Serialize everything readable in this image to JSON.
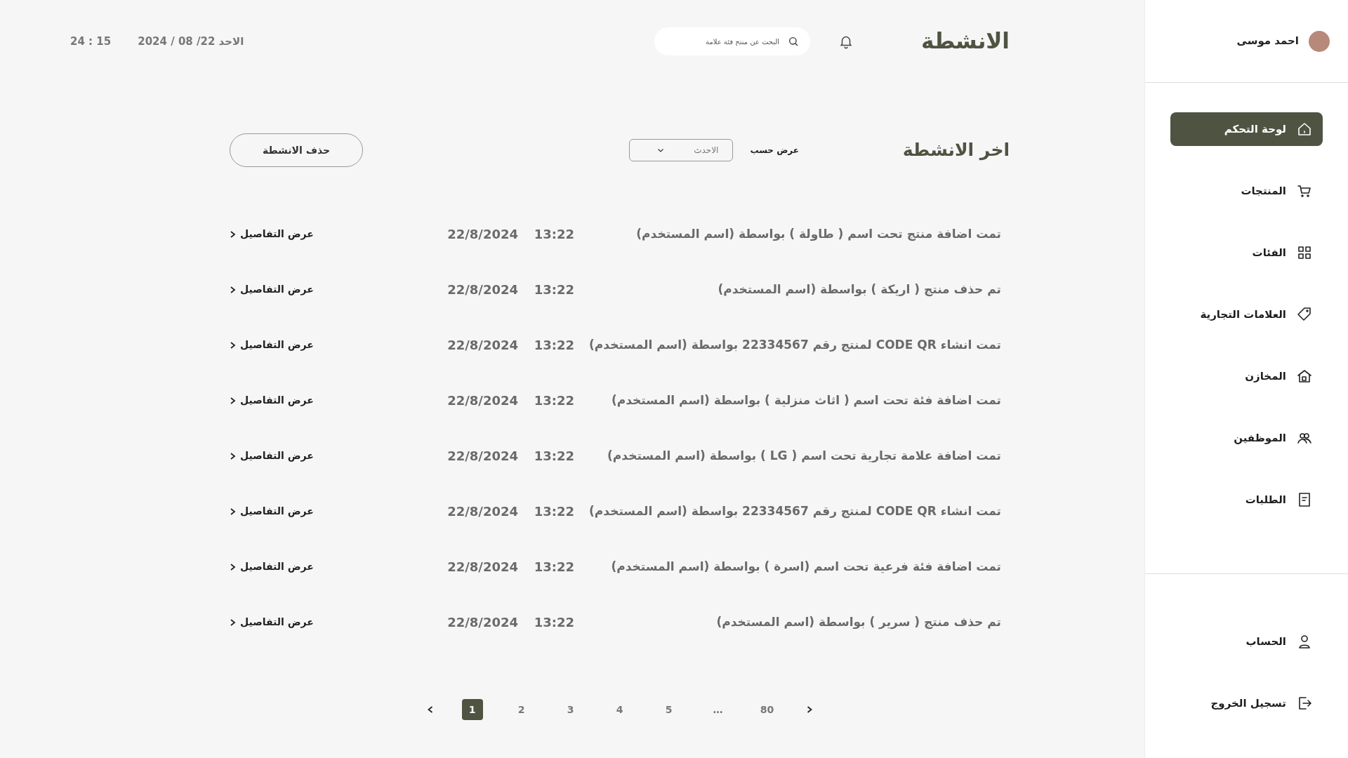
{
  "sidebar": {
    "user": {
      "name": "احمد موسى"
    },
    "items": [
      {
        "label": "لوحة التحكم",
        "selected": true
      },
      {
        "label": "المنتجات",
        "selected": false
      },
      {
        "label": "الفئات",
        "selected": false
      },
      {
        "label": "العلامات التجارية",
        "selected": false
      },
      {
        "label": "المخازن",
        "selected": false
      },
      {
        "label": "الموظفين",
        "selected": false
      },
      {
        "label": "الطلبات",
        "selected": false
      }
    ],
    "account_items": [
      {
        "label": "الحساب"
      },
      {
        "label": "تسجيل الخروج"
      }
    ]
  },
  "header": {
    "title": "الانشطة",
    "search": {
      "placeholder": "البحث عن منتج فئة علامة"
    },
    "date": "الاحد 22/ 08 / 2024",
    "time": "15 : 24"
  },
  "activity": {
    "heading": "اخر الانشطة",
    "sort_label": "عرض حسب",
    "sort_value": "الاحدث",
    "delete_button": "حذف الانشطة",
    "rows": [
      {
        "text": "تمت اضافة منتج تحت اسم ( طاولة ) بواسطة (اسم المستخدم)",
        "time": "13:22",
        "date": "22/8/2024",
        "link": "عرض التفاصيل"
      },
      {
        "text": "تم حذف  منتج ( اريكة )  بواسطة (اسم المستخدم)",
        "time": "13:22",
        "date": "22/8/2024",
        "link": "عرض التفاصيل"
      },
      {
        "text": "تمت انشاء CODE QR لمنتج رقم 22334567 بواسطة (اسم المستخدم)",
        "time": "13:22",
        "date": "22/8/2024",
        "link": "عرض التفاصيل"
      },
      {
        "text": "تمت اضافة فئة  تحت اسم ( اثاث منزلية )  بواسطة (اسم المستخدم)",
        "time": "13:22",
        "date": "22/8/2024",
        "link": "عرض التفاصيل"
      },
      {
        "text": "تمت اضافة علامة تجارية تحت اسم ( LG )  بواسطة (اسم المستخدم)",
        "time": "13:22",
        "date": "22/8/2024",
        "link": "عرض التفاصيل"
      },
      {
        "text": "تمت انشاء CODE QR لمنتج رقم 22334567 بواسطة (اسم المستخدم)",
        "time": "13:22",
        "date": "22/8/2024",
        "link": "عرض التفاصيل"
      },
      {
        "text": "تمت اضافة فئة فرعية تحت اسم (اسرة ) بواسطة (اسم المستخدم)",
        "time": "13:22",
        "date": "22/8/2024",
        "link": "عرض التفاصيل"
      },
      {
        "text": "تم حذف  منتج  ( سرير )  بواسطة (اسم المستخدم)",
        "time": "13:22",
        "date": "22/8/2024",
        "link": "عرض التفاصيل"
      }
    ]
  },
  "pagination": {
    "pages": [
      {
        "label": "80",
        "selected": false
      },
      {
        "label": "…",
        "selected": false
      },
      {
        "label": "5",
        "selected": false
      },
      {
        "label": "4",
        "selected": false
      },
      {
        "label": "3",
        "selected": false
      },
      {
        "label": "2",
        "selected": false
      },
      {
        "label": "1",
        "selected": true
      }
    ]
  }
}
